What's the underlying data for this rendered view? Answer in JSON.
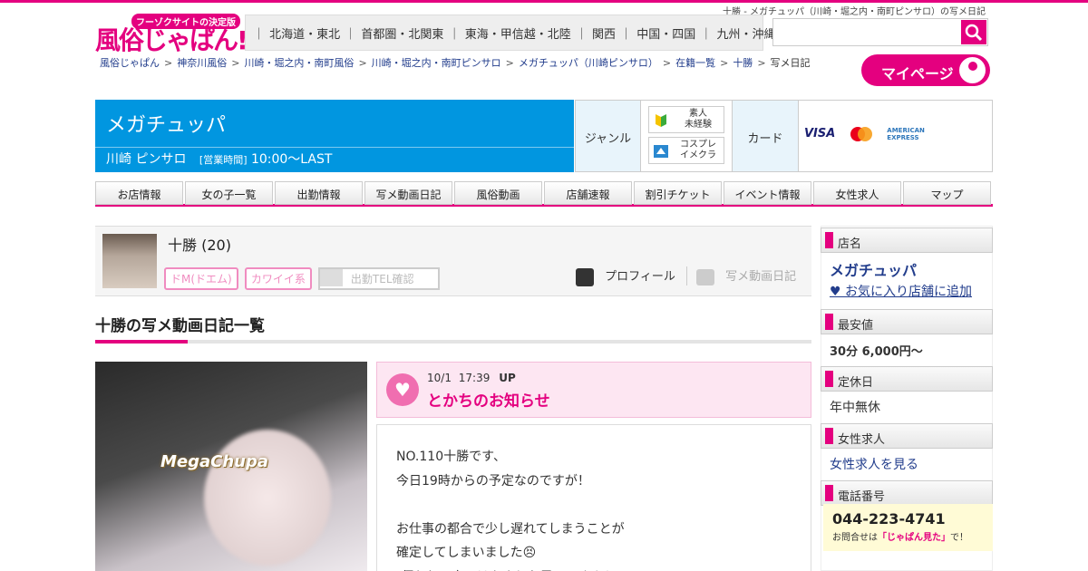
{
  "seo_title": "十勝 - メガチュッパ（川崎・堀之内・南町ピンサロ）の写メ日記",
  "logo": {
    "tag": "フーゾクサイトの決定版",
    "main": "風俗じゃぱん!"
  },
  "regions": [
    "北海道・東北",
    "首都圏・北関東",
    "東海・甲信越・北陸",
    "関西",
    "中国・四国",
    "九州・沖縄"
  ],
  "search": {
    "placeholder": "",
    "icon": "search-icon"
  },
  "breadcrumb": [
    "風俗じゃぱん",
    "神奈川風俗",
    "川崎・堀之内・南町風俗",
    "川崎・堀之内・南町ピンサロ",
    "メガチュッパ（川崎ピンサロ）",
    "在籍一覧",
    "十勝",
    "写メ日記"
  ],
  "mypage_label": "マイページ",
  "shop": {
    "name": "メガチュッパ",
    "area": "川崎 ピンサロ",
    "hours_label": "[営業時間]",
    "hours": "10:00～LAST"
  },
  "info": {
    "genre_label": "ジャンル",
    "genres": [
      "素人\n未経験",
      "コスプレ\nイメクラ"
    ],
    "card_label": "カード",
    "cards": [
      "VISA",
      "MasterCard",
      "AMERICAN EXPRESS"
    ]
  },
  "nav": [
    "お店情報",
    "女の子一覧",
    "出勤情報",
    "写メ動画日記",
    "風俗動画",
    "店舗速報",
    "割引チケット",
    "イベント情報",
    "女性求人",
    "マップ"
  ],
  "girl": {
    "name": "十勝",
    "age": "(20)",
    "tags": [
      "ドM(ドエム)",
      "カワイイ系"
    ],
    "tel_check": "出勤TEL確認",
    "profile_label": "プロフィール",
    "diary_label": "写メ動画日記"
  },
  "section_title": "十勝の写メ動画日記一覧",
  "photo_stamp": "MegaChupa",
  "diary": {
    "date": "10/1",
    "time": "17:39",
    "up": "UP",
    "title": "とかちのお知らせ",
    "lines": [
      "NO.110十勝です、",
      "今日19時からの予定なのですが！",
      "",
      "お仕事の都合で少し遅れてしまうことが",
      "確定してしまいました😣",
      "(伺われる方にはあまりお思いですよう)"
    ]
  },
  "sidebar": {
    "shop_h": "店名",
    "shop_name": "メガチュッパ",
    "fav": "♥ お気に入り店舗に追加",
    "price_h": "最安値",
    "price": "30分 6,000円～",
    "holiday_h": "定休日",
    "holiday": "年中無休",
    "recruit_h": "女性求人",
    "recruit": "女性求人を見る",
    "tel_h": "電話番号",
    "tel": "044-223-4741",
    "tel_note_pre": "お問合せは",
    "tel_note_em": "「じゃぱん見た」",
    "tel_note_post": "で！"
  },
  "colors": {
    "brand_pink": "#e4007f",
    "shop_blue": "#0196e0",
    "link_blue": "#223d8c"
  }
}
